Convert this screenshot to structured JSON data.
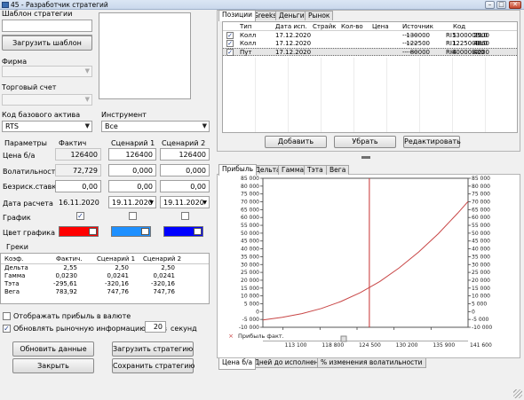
{
  "window": {
    "title": "45 - Разработчик стратегий",
    "min_glyph": "–",
    "max_glyph": "□",
    "close_glyph": "✕"
  },
  "left": {
    "template_label": "Шаблон стратегии",
    "load_template_button": "Загрузить шаблон",
    "firm_label": "Фирма",
    "account_label": "Торговый счет",
    "base_asset_label": "Код базового актива",
    "base_asset_value": "RTS",
    "instrument_label": "Инструмент",
    "instrument_value": "Все",
    "params": {
      "col_params": "Параметры",
      "col_actual": "Фактич",
      "col_s1": "Сценарий 1",
      "col_s2": "Сценарий 2",
      "price_label": "Цена б/а",
      "price": [
        "126400",
        "126400",
        "126400"
      ],
      "vol_label": "Волатильность",
      "vol": [
        "72,729",
        "0,000",
        "0,000"
      ],
      "rate_label": "Безриск.ставка",
      "rate": [
        "0,00",
        "0,00",
        "0,00"
      ],
      "date_label": "Дата расчета",
      "date": [
        "16.11.2020",
        "19.11.2020",
        "19.11.2020"
      ],
      "chart_label": "График",
      "color_label": "Цвет графика",
      "colors": [
        "#ff0000",
        "#1e90ff",
        "#0000ff"
      ]
    },
    "greeks": {
      "title": "Греки",
      "headers": [
        "Коэф.",
        "Фактич.",
        "Сценарий 1",
        "Сценарий 2"
      ],
      "rows": [
        [
          "Дельта",
          "2,55",
          "2,50",
          "2,50"
        ],
        [
          "Гамма",
          "0,0230",
          "0,0241",
          "0,0241"
        ],
        [
          "Тэта",
          "-295,61",
          "-320,16",
          "-320,16"
        ],
        [
          "Вега",
          "783,92",
          "747,76",
          "747,76"
        ]
      ]
    },
    "show_currency_label": "Отображать прибыль в валюте",
    "refresh_label": "Обновлять рыночную информацию раз в",
    "refresh_value": "20",
    "seconds_label": "секунд",
    "buttons": {
      "update": "Обновить данные",
      "load_strategy": "Загрузить стратегию",
      "close": "Закрыть",
      "save_strategy": "Сохранить стратегию"
    }
  },
  "positions": {
    "tabs": [
      "Позиции",
      "Greeks",
      "Деньги",
      "Рынок"
    ],
    "headers": [
      "Тип",
      "Дата исп.",
      "Страйк",
      "Кол-во",
      "Цена",
      "Источник",
      "Код"
    ],
    "rows": [
      [
        "Колл",
        "17.12.2020",
        "130000",
        "5",
        "2900",
        "-------",
        "RI130000BL0"
      ],
      [
        "Колл",
        "17.12.2020",
        "122500",
        "1",
        "4860",
        "-------",
        "RI122500BL0"
      ],
      [
        "Пут",
        "17.12.2020",
        "80000",
        "-4",
        "4200",
        "-------",
        "RI80000BX0"
      ]
    ],
    "buttons": {
      "add": "Добавить",
      "remove": "Убрать",
      "edit": "Редактировать"
    }
  },
  "chart_tabs": [
    "Прибыль",
    "Дельта",
    "Гамма",
    "Тэта",
    "Вега"
  ],
  "bottom_tabs": [
    "Цена б/а",
    "Дней до исполнения",
    "% изменения волатильности"
  ],
  "chart_data": {
    "type": "line",
    "xlabel": "",
    "ylabel": "",
    "xlim": [
      110000,
      141600
    ],
    "ylim": [
      -10000,
      85000
    ],
    "x_ticks": [
      "113 100",
      "118 800",
      "124 500",
      "130 200",
      "135 900"
    ],
    "x_tick_values": [
      113100,
      118800,
      124500,
      130200,
      135900
    ],
    "x_end_label": "141 600",
    "y_ticks": [
      85000,
      80000,
      75000,
      70000,
      65000,
      60000,
      55000,
      50000,
      45000,
      40000,
      35000,
      30000,
      25000,
      20000,
      15000,
      10000,
      5000,
      0,
      -5000,
      -10000
    ],
    "y_tick_labels": [
      "85 000",
      "80 000",
      "75 000",
      "70 000",
      "65 000",
      "60 000",
      "55 000",
      "50 000",
      "45 000",
      "40 000",
      "35 000",
      "30 000",
      "25 000",
      "20 000",
      "15 000",
      "10 000",
      "5 000",
      "0",
      "-5 000",
      "-10 000"
    ],
    "marker_x": 126400,
    "marker_color": "#c83232",
    "series": [
      {
        "name": "Прибыль факт.",
        "color": "#c84646",
        "x": [
          110000,
          113000,
          116000,
          119000,
          122000,
          125000,
          128000,
          131000,
          134000,
          137000,
          140000,
          141600
        ],
        "y": [
          -5300,
          -3600,
          -1300,
          2000,
          6400,
          12100,
          19200,
          27900,
          38000,
          49600,
          62700,
          70200
        ]
      }
    ]
  }
}
